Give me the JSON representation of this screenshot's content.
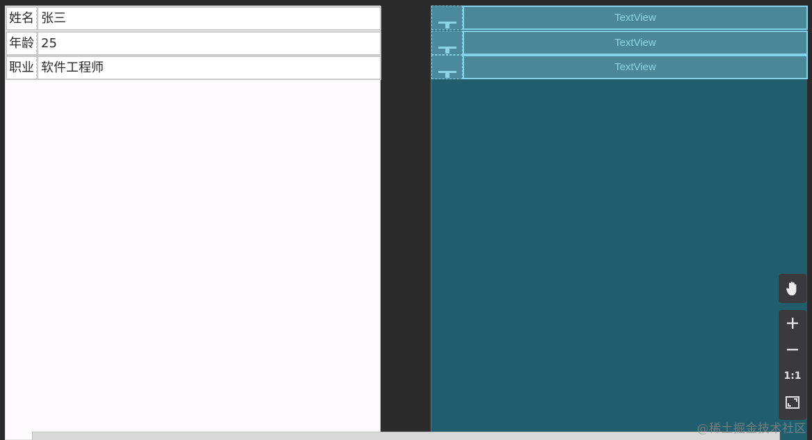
{
  "design_table": {
    "rows": [
      {
        "label": "姓名",
        "value": "张三"
      },
      {
        "label": "年龄",
        "value": "25"
      },
      {
        "label": "职业",
        "value": "软件工程师"
      }
    ]
  },
  "blueprint": {
    "rows": [
      {
        "text": "TextView"
      },
      {
        "text": "TextView"
      },
      {
        "text": "TextView"
      }
    ]
  },
  "toolbar": {
    "pan": {
      "icon": "hand-icon"
    },
    "zoom_in": {
      "icon": "plus-icon",
      "label": "+"
    },
    "zoom_out": {
      "icon": "minus-icon",
      "label": "−"
    },
    "actual_size": {
      "icon": "one-to-one-icon",
      "label": "1:1"
    },
    "fit_screen": {
      "icon": "fit-screen-icon"
    }
  },
  "watermark": "@稀土掘金技术社区",
  "colors": {
    "design_background": "#fefbfe",
    "blueprint_background": "#215e6d",
    "blueprint_accent": "#86d2e8",
    "canvas_background": "#2b2b2c"
  }
}
